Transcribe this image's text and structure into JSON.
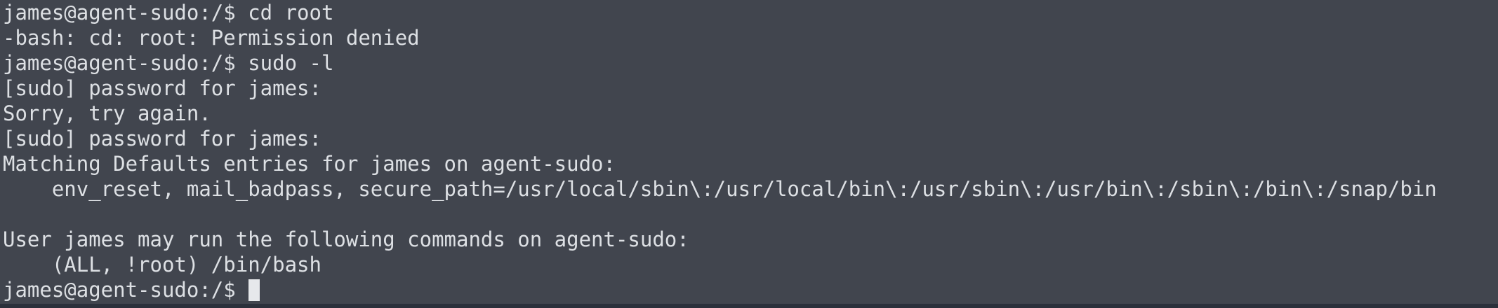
{
  "terminal": {
    "lines": [
      "james@agent-sudo:/$ cd root",
      "-bash: cd: root: Permission denied",
      "james@agent-sudo:/$ sudo -l",
      "[sudo] password for james:",
      "Sorry, try again.",
      "[sudo] password for james:",
      "Matching Defaults entries for james on agent-sudo:",
      "    env_reset, mail_badpass, secure_path=/usr/local/sbin\\:/usr/local/bin\\:/usr/sbin\\:/usr/bin\\:/sbin\\:/bin\\:/snap/bin",
      "",
      "User james may run the following commands on agent-sudo:",
      "    (ALL, !root) /bin/bash",
      "james@agent-sudo:/$ "
    ]
  }
}
